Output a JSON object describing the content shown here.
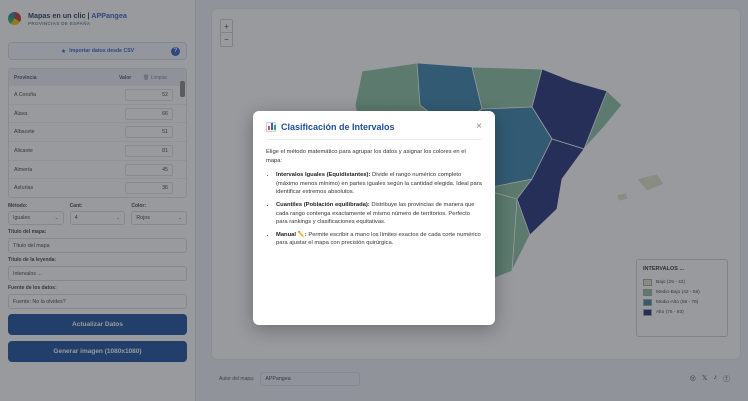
{
  "brand": {
    "title": "Mapas en un clic | ",
    "title_accent": "APPangea",
    "subtitle": "PROVINCIAS DE ESPAÑA"
  },
  "sidebar": {
    "import_label": "Importar datos desde CSV",
    "table": {
      "col_province": "Provincia",
      "col_value": "Valor",
      "col_clear": "Limpiar",
      "rows": [
        {
          "name": "A Coruña",
          "value": "52"
        },
        {
          "name": "Álava",
          "value": "66"
        },
        {
          "name": "Albacete",
          "value": "51"
        },
        {
          "name": "Alicante",
          "value": "81"
        },
        {
          "name": "Almería",
          "value": "45"
        },
        {
          "name": "Asturias",
          "value": "36"
        }
      ]
    },
    "method_label": "Método:",
    "method_value": "Iguales",
    "count_label": "Cant:",
    "count_value": "4",
    "color_label": "Color:",
    "color_value": "Rojos",
    "map_title_label": "Título del mapa:",
    "map_title_value": "Título del mapa",
    "legend_title_label": "Título de la leyenda:",
    "legend_title_value": "Intervalos ...",
    "source_label": "Fuente de los datos:",
    "source_value": "Fuente: No la olvides?",
    "update_button": "Actualizar Datos",
    "generate_button": "Generar imagen (1080x1080)"
  },
  "map": {
    "zoom_in": "+",
    "zoom_out": "−",
    "legend": {
      "title": "INTERVALOS ...",
      "items": [
        {
          "label": "Bajo (25 - 42)",
          "color": "#dfe6c7"
        },
        {
          "label": "Medio-Bajo (42 - 59)",
          "color": "#8cc2a3"
        },
        {
          "label": "Medio-Alto (59 - 76)",
          "color": "#3d86ad"
        },
        {
          "label": "Alto (76 - 93)",
          "color": "#24337a"
        }
      ]
    },
    "author_label": "Autor del mapa:",
    "author_value": "APPangea"
  },
  "modal": {
    "title": "Clasificación de Intervalos",
    "close": "×",
    "intro": "Elige el método matemático para agrupar los datos y asignar los colores en el mapa:",
    "items": [
      {
        "term": "Intervalos Iguales (Equidistantes):",
        "desc": " Divide el rango numérico completo (máximo menos mínimo) en partes iguales según la cantidad elegida. Ideal para identificar extremos absolutos."
      },
      {
        "term": "Cuantiles (Población equilibrada):",
        "desc": " Distribuye las provincias de manera que cada rango contenga exactamente el mismo número de territorios. Perfecto para rankings y clasificaciones equitativas."
      },
      {
        "term": "Manual ✏️:",
        "desc": " Permite escribir a mano los límites exactos de cada corte numérico para ajustar el mapa con precisión quirúrgica."
      }
    ]
  }
}
